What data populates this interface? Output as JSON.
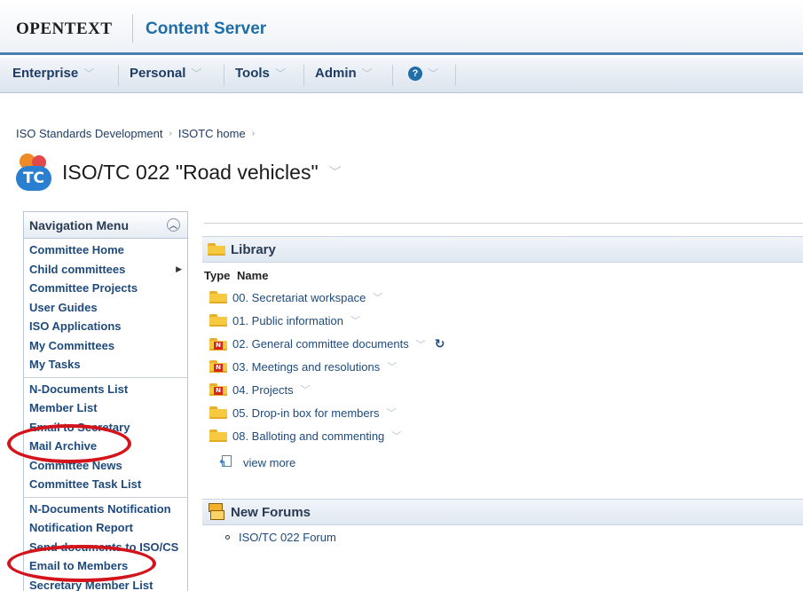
{
  "header": {
    "brand": "OPENTEXT",
    "product": "Content Server"
  },
  "menu": {
    "items": [
      {
        "label": "Enterprise"
      },
      {
        "label": "Personal"
      },
      {
        "label": "Tools"
      },
      {
        "label": "Admin"
      }
    ],
    "help_icon": "help-icon"
  },
  "breadcrumb": {
    "items": [
      "ISO Standards Development",
      "ISOTC home"
    ]
  },
  "page": {
    "logo_text": "TC",
    "title": "ISO/TC 022 \"Road vehicles\""
  },
  "nav": {
    "title": "Navigation Menu",
    "groups": [
      [
        "Committee Home",
        "Child committees",
        "Committee Projects",
        "User Guides",
        "ISO Applications",
        "My Committees",
        "My Tasks"
      ],
      [
        "N-Documents List",
        "Member List",
        "Email to Secretary",
        "Mail Archive",
        "Committee News",
        "Committee Task List"
      ],
      [
        "N-Documents Notification",
        "Notification Report",
        "Send documents to ISO/CS",
        "Email to Members",
        "Secretary Member List"
      ]
    ]
  },
  "library": {
    "title": "Library",
    "columns": {
      "type": "Type",
      "name": "Name"
    },
    "rows": [
      {
        "name": "00. Secretariat workspace",
        "icon": "folder-icon"
      },
      {
        "name": "01. Public information",
        "icon": "folder-icon"
      },
      {
        "name": "02. General committee documents",
        "icon": "n-folder-icon"
      },
      {
        "name": "03. Meetings and resolutions",
        "icon": "n-folder-icon"
      },
      {
        "name": "04. Projects",
        "icon": "n-folder-icon"
      },
      {
        "name": "05. Drop-in box for members",
        "icon": "folder-icon"
      },
      {
        "name": "08. Balloting and commenting",
        "icon": "folder-icon"
      }
    ],
    "view_more": "view more"
  },
  "forums": {
    "title": "New Forums",
    "items": [
      "ISO/TC 022 Forum"
    ]
  },
  "colors": {
    "accent": "#1f6ea8",
    "link": "#1e4a7c",
    "highlight_ellipse": "#d4141b"
  }
}
